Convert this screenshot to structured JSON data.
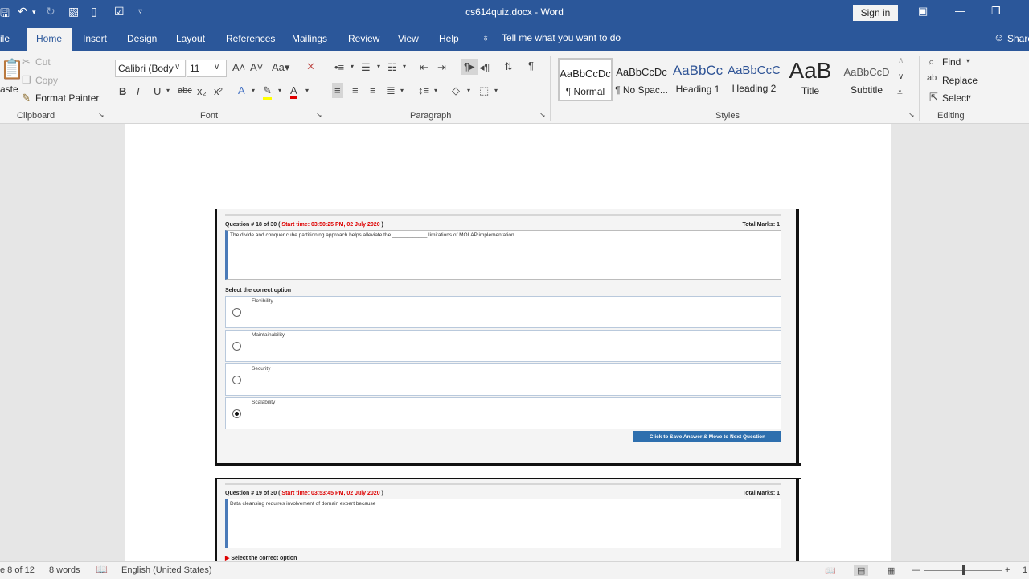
{
  "title_bar": {
    "document_title": "cs614quiz.docx  -  Word",
    "sign_in_label": "Sign in",
    "icons": [
      "save-icon",
      "undo-icon",
      "redo-icon",
      "touch-mode-icon",
      "new-doc-icon",
      "check-icon",
      "customize-icon"
    ]
  },
  "tabs": [
    {
      "label": "ile"
    },
    {
      "label": "Home"
    },
    {
      "label": "Insert"
    },
    {
      "label": "Design"
    },
    {
      "label": "Layout"
    },
    {
      "label": "References"
    },
    {
      "label": "Mailings"
    },
    {
      "label": "Review"
    },
    {
      "label": "View"
    },
    {
      "label": "Help"
    }
  ],
  "tell_me": "Tell me what you want to do",
  "share_label": "Share",
  "clipboard": {
    "paste_label": "aste",
    "cut_label": "Cut",
    "copy_label": "Copy",
    "format_painter_label": "Format Painter",
    "group_label": "Clipboard"
  },
  "font": {
    "font_name": "Calibri (Body",
    "font_size": "11",
    "group_label": "Font"
  },
  "paragraph": {
    "group_label": "Paragraph"
  },
  "styles": {
    "items": [
      {
        "preview": "AaBbCcDc",
        "name": "¶ Normal"
      },
      {
        "preview": "AaBbCcDc",
        "name": "¶ No Spac..."
      },
      {
        "preview": "AaBbCc",
        "name": "Heading 1"
      },
      {
        "preview": "AaBbCcC",
        "name": "Heading 2"
      },
      {
        "preview": "AaB",
        "name": "Title"
      },
      {
        "preview": "AaBbCcD",
        "name": "Subtitle"
      }
    ],
    "group_label": "Styles"
  },
  "editing": {
    "find_label": "Find",
    "replace_label": "Replace",
    "select_label": "Select",
    "group_label": "Editing"
  },
  "question1": {
    "header_prefix": "Question # 18 of 30 (",
    "start_time": "Start time: 03:50:25 PM, 02 July 2020",
    "header_suffix": ")",
    "total_marks": "Total Marks: 1",
    "text": "The divide and conquer cube partitioning approach helps alleviate the ____________ limitations of MOLAP implementation",
    "select_label": "Select the correct option",
    "options": [
      {
        "label": "Flexibility",
        "selected": false
      },
      {
        "label": "Maintainability",
        "selected": false
      },
      {
        "label": "Security",
        "selected": false
      },
      {
        "label": "Scalability",
        "selected": true
      }
    ],
    "save_button": "Click to Save Answer & Move to Next Question"
  },
  "question2": {
    "header_prefix": "Question # 19 of 30 (",
    "start_time": "Start time: 03:53:45 PM, 02 July 2020",
    "header_suffix": ")",
    "total_marks": "Total Marks: 1",
    "text": "Data cleansing requires involvement of domain expert because",
    "select_label": "Select the correct option"
  },
  "status_bar": {
    "page": "e 8 of 12",
    "words": "8 words",
    "language": "English (United States)",
    "zoom": "1"
  }
}
